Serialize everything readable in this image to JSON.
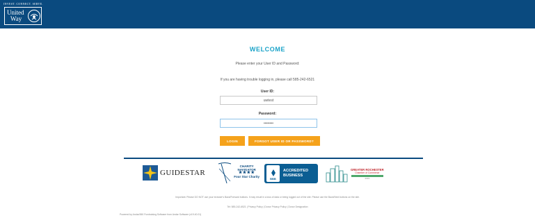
{
  "header": {
    "tagline": "INVEST. CONNECT. SERVE.",
    "logo_line1": "United",
    "logo_line2": "Way",
    "brand_color": "#0a4a7f"
  },
  "welcome": {
    "title": "WELCOME",
    "instruction": "Please enter your User ID and Password:",
    "help": "If you are having trouble logging in, please call 585-242-6521"
  },
  "form": {
    "user_id_label": "User ID:",
    "user_id_value": "uwtest",
    "password_label": "Password:",
    "password_value": "••••••••",
    "login_label": "LOGIN",
    "forgot_label": "FORGOT USER ID OR PASSWORD?"
  },
  "badges": {
    "guidestar": "GUIDESTAR",
    "charity_line1": "CHARITY",
    "charity_line2": "NAVIGATOR",
    "charity_stars": "★★★★",
    "charity_line3": "Four Star Charity",
    "bbb_seal": "BBB",
    "bbb_line1": "ACCREDITED",
    "bbb_line2": "BUSINESS",
    "grc_line1": "GREATER ROCHESTER",
    "grc_line2": "Chamber of Commerce",
    "grc_line3": "2019"
  },
  "footer": {
    "notice": "Important: Please DO NOT use your browser's Back/Forward buttons. It may result in a loss of data or being logged out of the site. Please use the Back/Next buttons on the site.",
    "contact": "Tel: 585-242-6521 | Privacy Policy | Donor Privacy Policy | Donor Designation",
    "powered": "Powered by Andar/360 Fundraising Software from Andar Software (v19.40.01)"
  },
  "colors": {
    "accent": "#1aa3c8",
    "button": "#f5a21b",
    "bbb": "#0b5e93"
  }
}
